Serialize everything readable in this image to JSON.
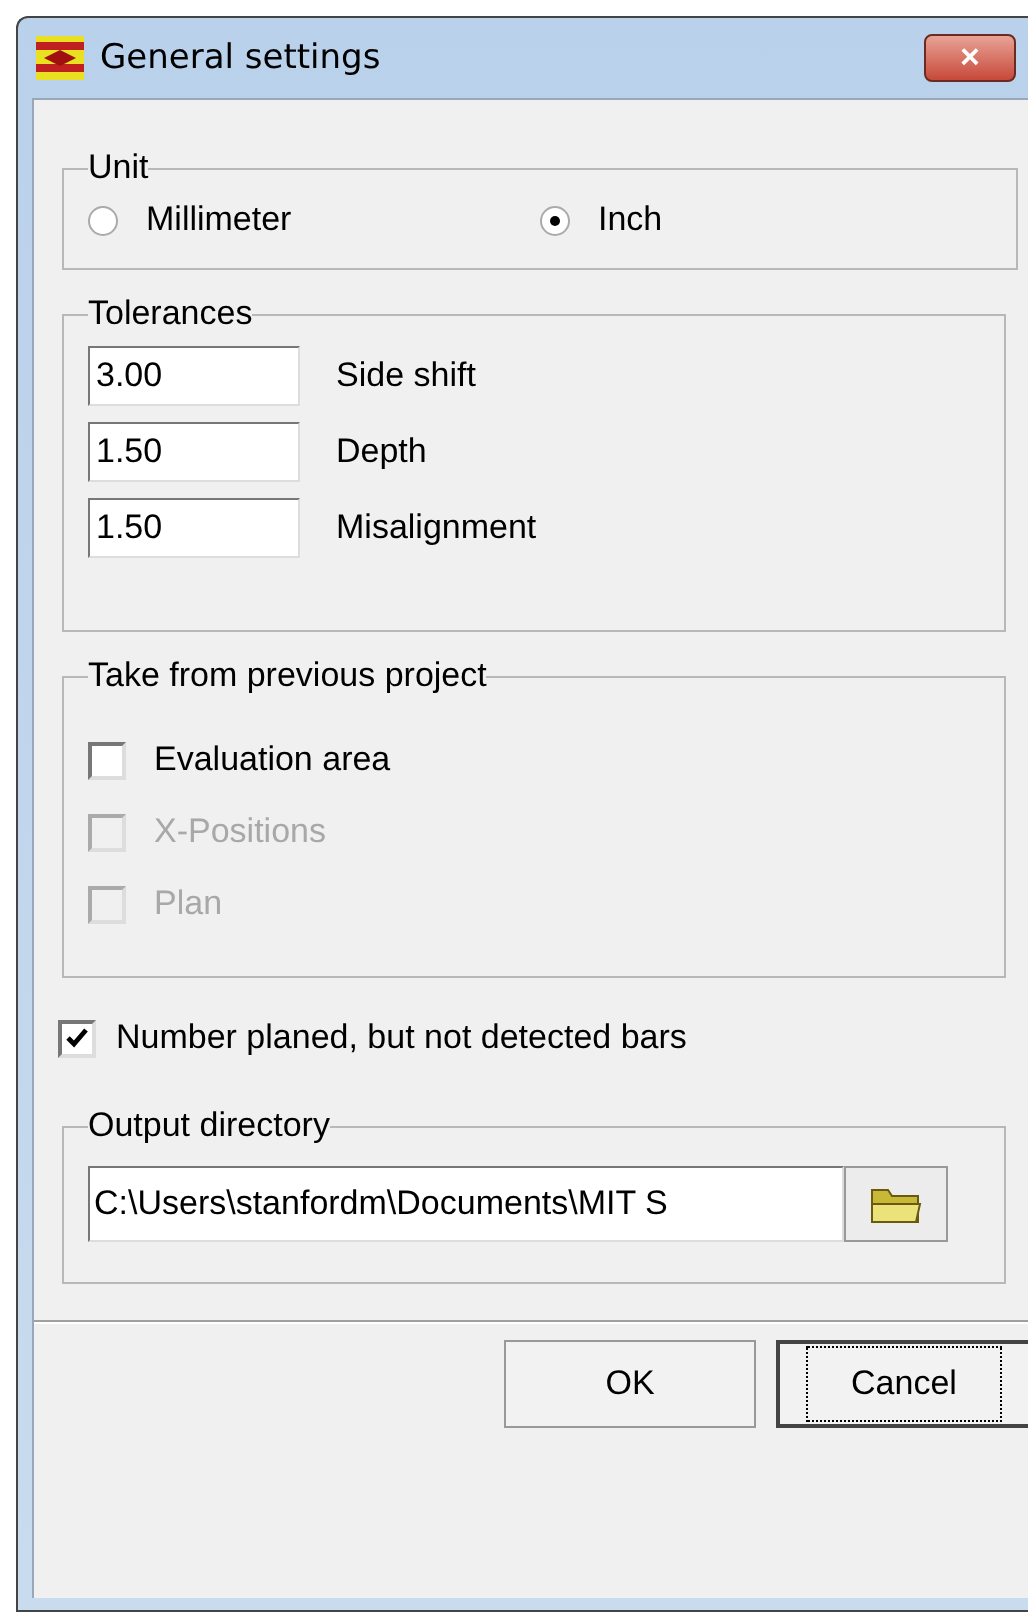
{
  "window": {
    "title": "General settings",
    "close": "×"
  },
  "unit": {
    "title": "Unit",
    "options": [
      {
        "label": "Millimeter",
        "selected": false
      },
      {
        "label": "Inch",
        "selected": true
      }
    ]
  },
  "tolerances": {
    "title": "Tolerances",
    "fields": [
      {
        "value": "3.00",
        "label": "Side shift"
      },
      {
        "value": "1.50",
        "label": "Depth"
      },
      {
        "value": "1.50",
        "label": "Misalignment"
      }
    ]
  },
  "take_from_previous": {
    "title": "Take from previous project",
    "items": [
      {
        "label": "Evaluation area",
        "checked": false,
        "disabled": false
      },
      {
        "label": "X-Positions",
        "checked": false,
        "disabled": true
      },
      {
        "label": "Plan",
        "checked": false,
        "disabled": true
      }
    ]
  },
  "number_option": {
    "label": "Number planed, but not detected bars",
    "checked": true
  },
  "output_directory": {
    "title": "Output directory",
    "value": "C:\\Users\\stanfordm\\Documents\\MIT S"
  },
  "buttons": [
    {
      "label": "OK",
      "focused": false
    },
    {
      "label": "Cancel",
      "focused": true
    }
  ]
}
